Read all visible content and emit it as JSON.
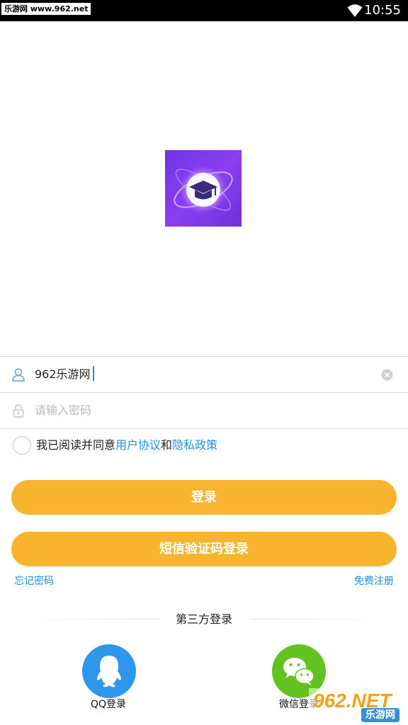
{
  "status_bar": {
    "watermark": "乐游网 www.962.net",
    "time": "10:55"
  },
  "login": {
    "username_value": "962乐游网",
    "password_placeholder": "请输入密码",
    "agree_prefix": "我已阅读并同意",
    "user_agreement": "用户协议",
    "and": "和",
    "privacy_policy": "隐私政策",
    "login_button": "登录",
    "sms_login_button": "短信验证码登录",
    "forgot_password": "忘记密码",
    "register": "免费注册"
  },
  "third_party": {
    "title": "第三方登录",
    "qq_label": "QQ登录",
    "wechat_label": "微信登录"
  },
  "corner_watermark": {
    "brand": "962.NET",
    "site": "乐游网"
  },
  "colors": {
    "accent": "#f8b42e",
    "link": "#1e8ee0",
    "qq": "#2f97eb",
    "wechat": "#62c21f",
    "logo_bg": "#7a38ec"
  },
  "icons": [
    "wifi-icon",
    "user-icon",
    "lock-icon",
    "clear-icon",
    "checkbox",
    "qq-icon",
    "wechat-icon",
    "app-logo"
  ]
}
